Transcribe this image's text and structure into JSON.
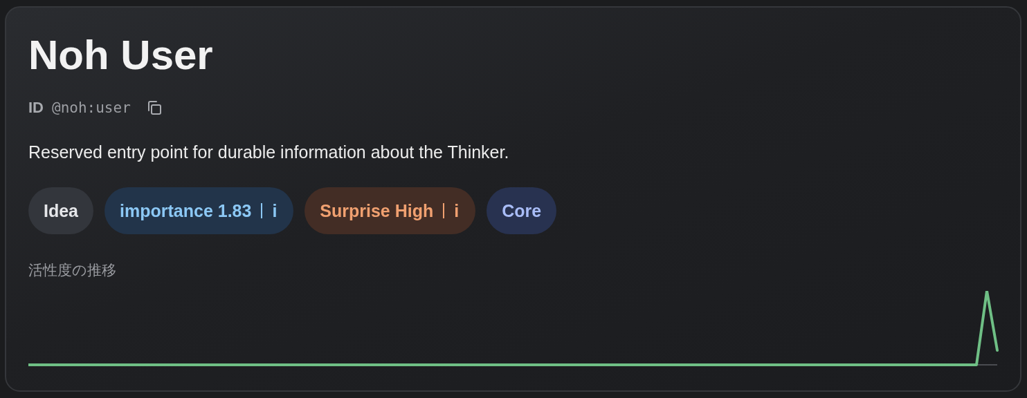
{
  "title": "Noh User",
  "id": {
    "label": "ID",
    "value": "@noh:user"
  },
  "description": "Reserved entry point for durable information about the Thinker.",
  "tags": [
    {
      "label": "Idea",
      "color": "#e6e7ea"
    },
    {
      "label": "importance 1.83",
      "color": "#8cc8f5",
      "info": "i"
    },
    {
      "label": "Surprise High",
      "color": "#f0a070",
      "info": "i"
    },
    {
      "label": "Core",
      "color": "#a9bdf7"
    }
  ],
  "activity": {
    "label": "活性度の推移"
  }
}
